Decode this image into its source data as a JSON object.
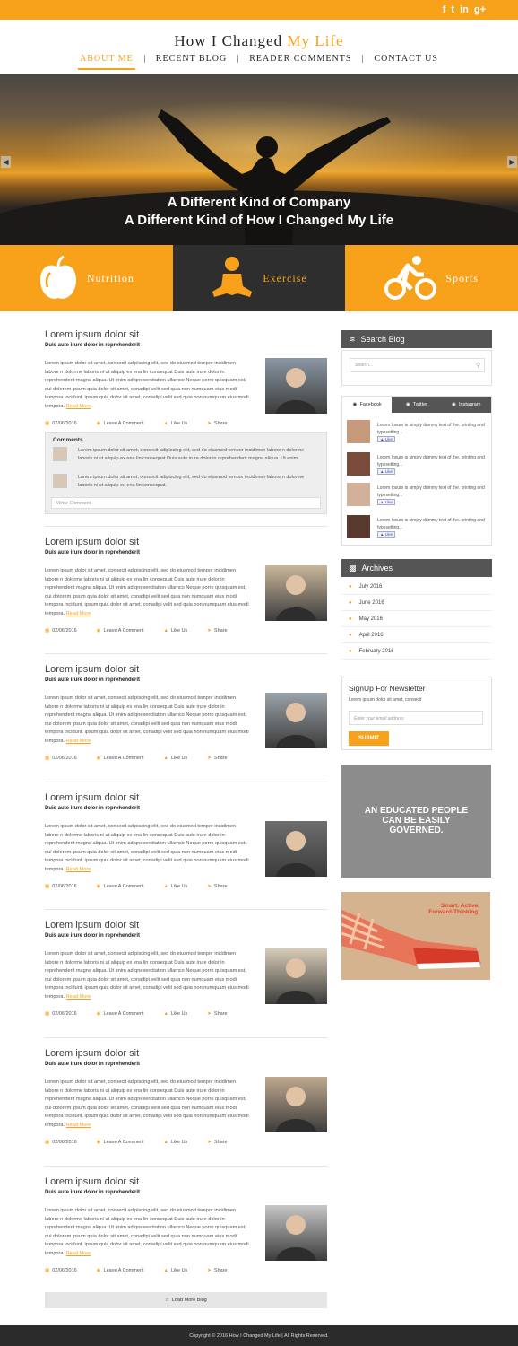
{
  "social_links": [
    "f",
    "t",
    "in",
    "g+"
  ],
  "header": {
    "title_main": "How I Changed ",
    "title_accent": "My Life"
  },
  "nav": [
    {
      "label": "ABOUT ME",
      "active": true
    },
    {
      "label": "RECENT BLOG"
    },
    {
      "label": "READER COMMENTS"
    },
    {
      "label": "CONTACT US"
    }
  ],
  "hero": {
    "line1": "A Different Kind of Company",
    "line2": "A Different Kind of How I Changed My Life"
  },
  "features": [
    {
      "label": "Nutrition",
      "icon": "apple-icon"
    },
    {
      "label": "Exercise",
      "icon": "meditation-icon"
    },
    {
      "label": "Sports",
      "icon": "cycling-icon"
    }
  ],
  "post_common": {
    "title": "Lorem ipsum dolor sit",
    "subtitle": "Duis aute irure dolor in reprehenderit",
    "body": "Lorem ipsum dolor sit amet, consecit adipiscing elit, sed do eiusmod tempor incidimen labore n dolorme laboris ni ut aliquip ex ena lin consequat Duis aute irure dolor in reprehenderit magna aliqua. Ut enim ad qnexercitation ullamco Neque porro quisquam est, qui dolorem ipsum quia dolor sit amet, conadipi velit sed quia non numquam eius modi tempora incidunt. ipsum quia dolor sit amet, conadipi velit sed quia non numquam eius modi tempora.",
    "read_more": "Read More",
    "date": "02/06/2016",
    "comment_label": "Leave A Comment",
    "like_label": "Like Us",
    "share_label": "Share"
  },
  "comments": {
    "title": "Comments",
    "items": [
      "Lorem ipsum dolor sit amet, consecit adipiscing elit, sed do eiusmod tempor incidimen labore n dolorme laboris ni ut aliquip ex ena lin consequat Duis aute irure dolor in reprehenderit magna aliqua. Ut enim",
      "Lorem ipsum dolor sit amet, consecit adipiscing elit, sed do eiusmod tempor incidimen labore n dolorme laboris ni ut aliquip ex ena lin consequat."
    ],
    "placeholder": "Write Comment"
  },
  "load_more": "Load More Blog",
  "sidebar": {
    "search_title": "Search Blog",
    "search_placeholder": "Search...",
    "tabs": [
      "Facebook",
      "Twitter",
      "Instagram"
    ],
    "feed_text": "Lorem Ipsum is simply dummy text of the. printing and typesetting...",
    "feed_like": "Like",
    "archives_title": "Archives",
    "archives": [
      "July 2016",
      "June 2016",
      "May 2016",
      "April 2016",
      "February 2016"
    ],
    "newsletter_title": "SignUp For Newsletter",
    "newsletter_sub": "Lorem ipsum dolor sit amet, consecit",
    "newsletter_placeholder": "Enter your email address",
    "newsletter_button": "SUBMIT",
    "ad1_line1": "AN EDUCATED PEOPLE",
    "ad1_line2": "CAN BE EASILY",
    "ad1_line3": "GOVERNED.",
    "ad2_line1": "Smart. Active.",
    "ad2_line2": "Forward-Thinking."
  },
  "footer": "Copyright © 2016 How I Changed My Life  |  All Rights Reserved.",
  "colors": {
    "accent": "#f7a21a",
    "dark": "#2e2e2e",
    "widget_head": "#555555"
  }
}
